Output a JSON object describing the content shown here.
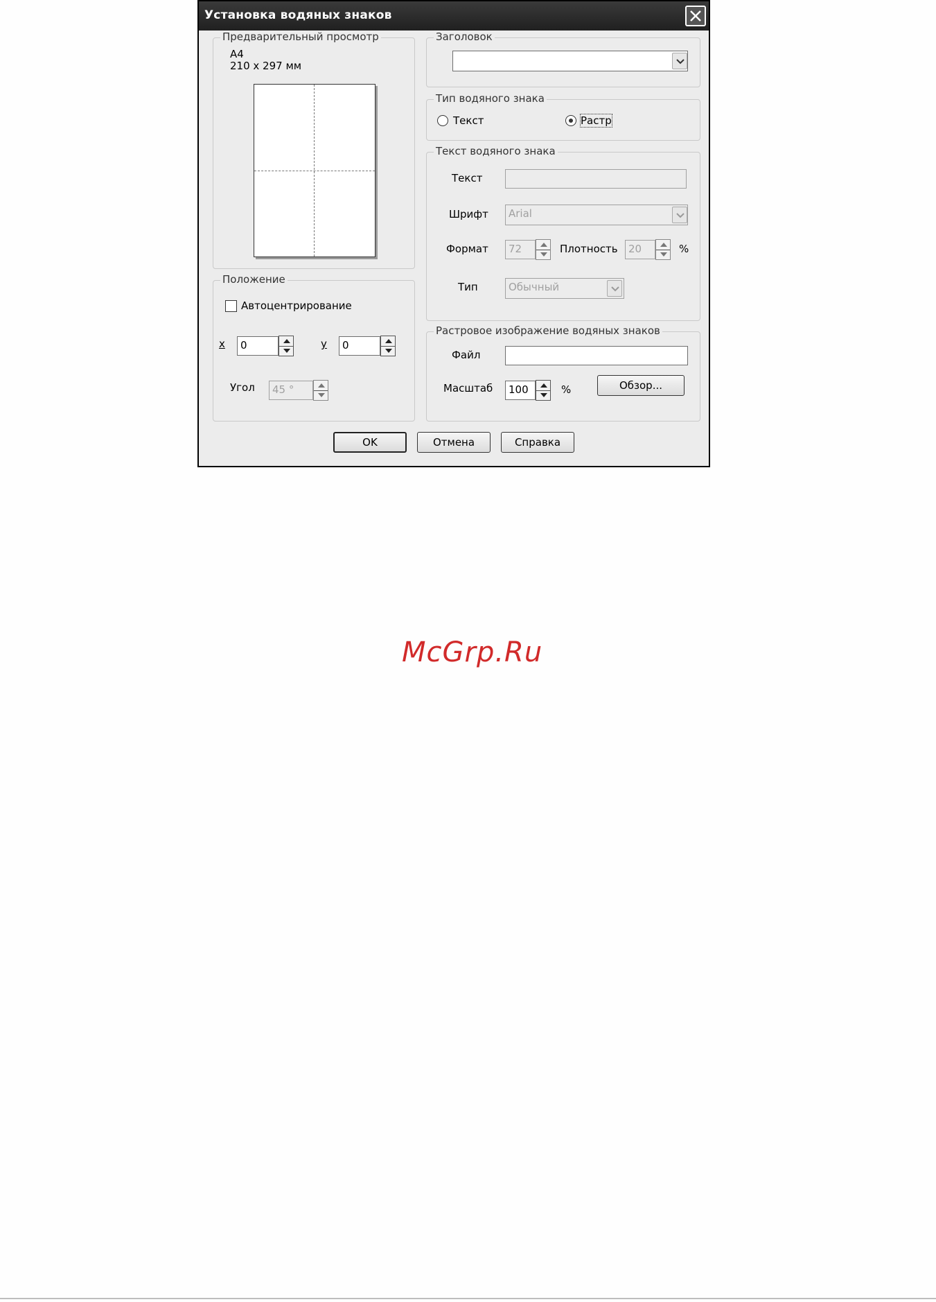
{
  "dialog": {
    "title": "Установка водяных знаков",
    "close_icon": "close-icon"
  },
  "preview": {
    "legend": "Предварительный просмотр",
    "paper_size": "A4",
    "paper_dims": "210 x 297 мм"
  },
  "position": {
    "legend": "Положение",
    "autocenter_label": "Автоцентрирование",
    "autocenter_checked": false,
    "x_label": "x",
    "x_value": "0",
    "y_label": "y",
    "y_value": "0",
    "angle_label": "Угол",
    "angle_value": "45 °"
  },
  "header": {
    "legend": "Заголовок",
    "selected": ""
  },
  "watermark_type": {
    "legend": "Тип водяного знака",
    "options": [
      {
        "label": "Текст",
        "selected": false
      },
      {
        "label": "Растр",
        "selected": true
      }
    ]
  },
  "watermark_text": {
    "legend": "Текст водяного знака",
    "text_label": "Текст",
    "text_value": "",
    "font_label": "Шрифт",
    "font_value": "Arial",
    "size_label": "Формат",
    "size_value": "72",
    "density_label": "Плотность",
    "density_value": "20",
    "density_unit": "%",
    "type_label": "Тип",
    "type_value": "Обычный"
  },
  "bitmap": {
    "legend": "Растровое изображение водяных знаков",
    "file_label": "Файл",
    "file_value": "",
    "scale_label": "Масштаб",
    "scale_value": "100",
    "scale_unit": "%",
    "browse_label": "Обзор..."
  },
  "buttons": {
    "ok": "OK",
    "cancel": "Отмена",
    "help": "Справка"
  },
  "logo": {
    "text": "McGrp.Ru",
    "color": "#d12a2a"
  }
}
